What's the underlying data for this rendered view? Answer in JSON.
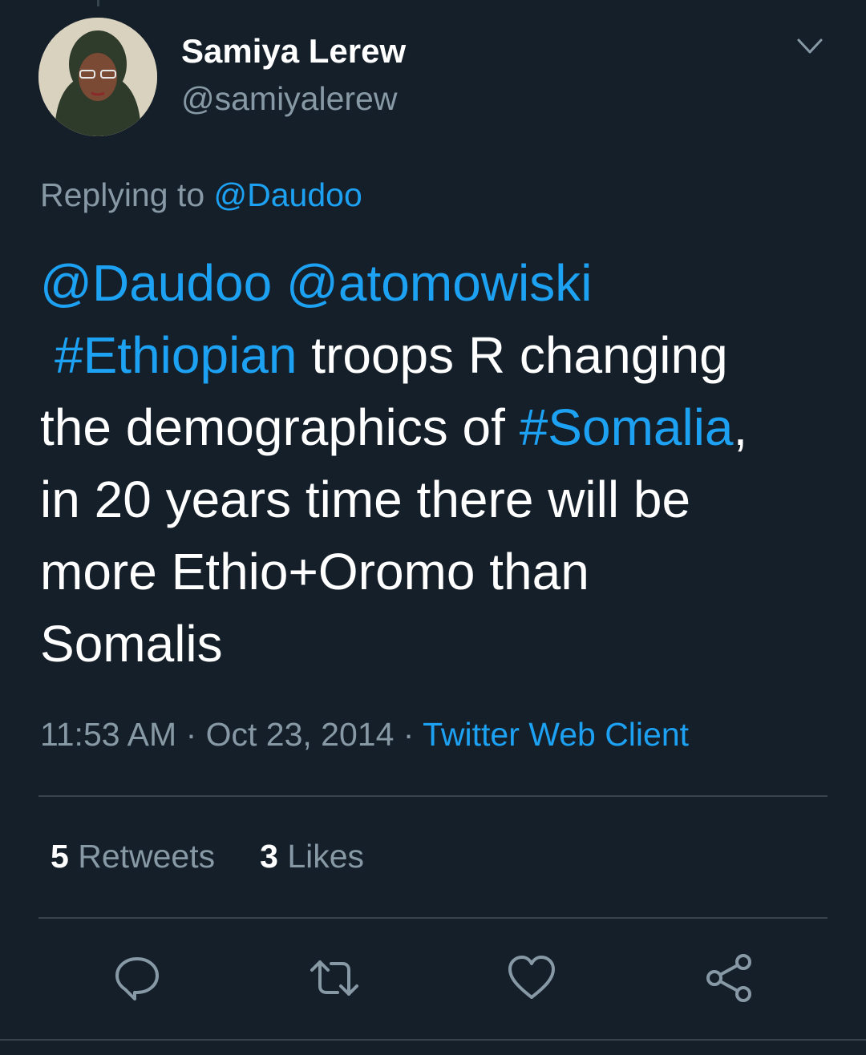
{
  "tweet": {
    "author": {
      "display_name": "Samiya Lerew",
      "handle": "@samiyalerew"
    },
    "reply_context": {
      "prefix": "Replying to ",
      "handle": "@Daudoo"
    },
    "body": {
      "line1": {
        "mention1": "@Daudoo",
        "space": " ",
        "mention2": "@atomowiski"
      },
      "line2": {
        "hashtag": "#Ethiopian",
        "text": " troops R changing"
      },
      "line3": {
        "text": "the demographics of ",
        "hashtag": "#Somalia",
        "trail": ","
      },
      "line4": "in 20 years time there will be",
      "line5": "more Ethio+Oromo than",
      "line6": "Somalis"
    },
    "time": "11:53 AM",
    "separator1": " · ",
    "date": "Oct 23, 2014",
    "separator2": " · ",
    "source": "Twitter Web Client",
    "stats": {
      "retweets_count": "5",
      "retweets_label": " Retweets",
      "likes_count": "3",
      "likes_label": " Likes"
    }
  },
  "icons": {
    "menu": "chevron-down-icon",
    "reply": "reply-icon",
    "retweet": "retweet-icon",
    "like": "heart-icon",
    "share": "share-icon"
  },
  "colors": {
    "background": "#151f2a",
    "link": "#1da1f2",
    "secondary_text": "#8899a6",
    "divider": "#38444d"
  }
}
